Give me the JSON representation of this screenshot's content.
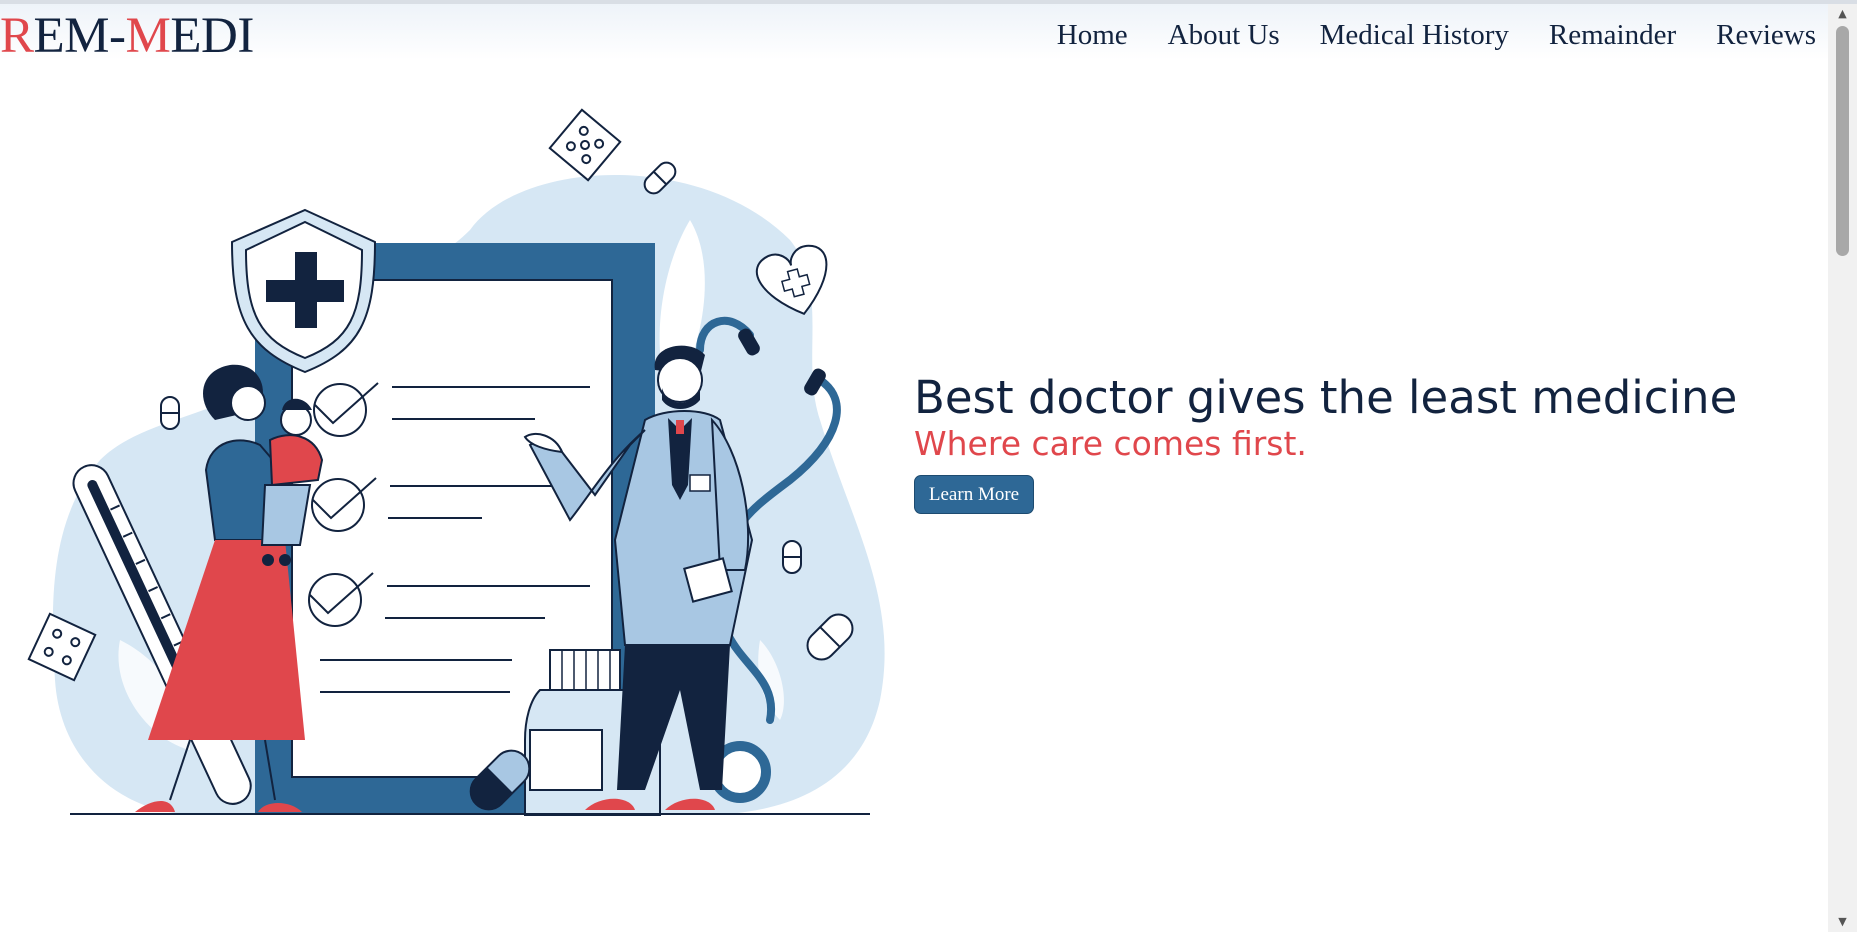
{
  "brand": {
    "part1_accent": "R",
    "part1": "EM-",
    "part2_accent": "M",
    "part2": "EDI"
  },
  "nav": {
    "items": [
      {
        "label": "Home"
      },
      {
        "label": "About Us"
      },
      {
        "label": "Medical History"
      },
      {
        "label": "Remainder"
      },
      {
        "label": "Reviews"
      }
    ]
  },
  "hero": {
    "headline": "Best doctor gives the least medicine",
    "tagline": "Where care comes first.",
    "cta_label": "Learn More"
  },
  "scrollbar": {
    "up_icon": "▲",
    "down_icon": "▼"
  },
  "colors": {
    "navy": "#12233f",
    "accent_red": "#e0474c",
    "button_blue": "#2e6896",
    "blob_blue": "#d6e7f4"
  }
}
